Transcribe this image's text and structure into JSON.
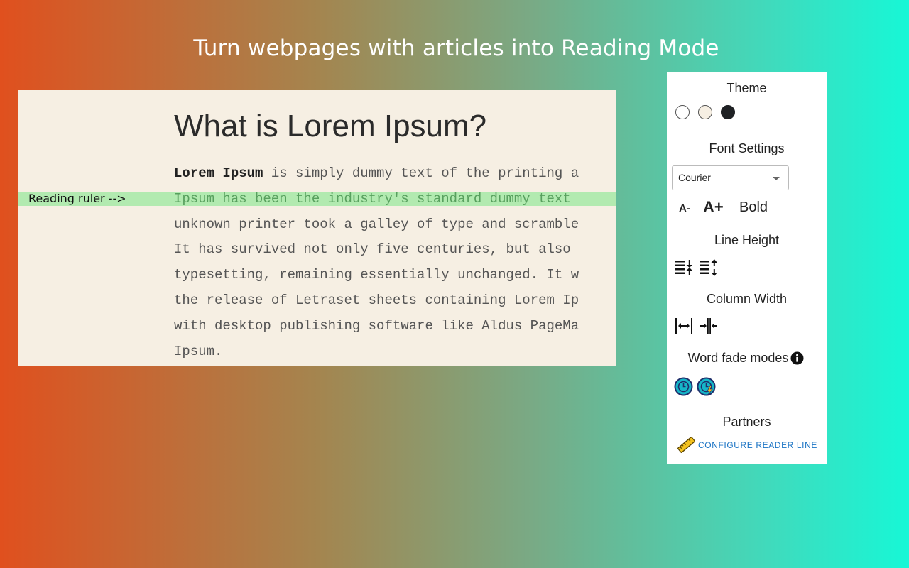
{
  "headline": "Turn webpages with articles into Reading Mode",
  "article": {
    "title": "What is Lorem Ipsum?",
    "line1_bold": "Lorem Ipsum",
    "line1_rest": " is simply dummy text of the printing a",
    "lines": [
      "Ipsum has been the industry's standard dummy text",
      "unknown printer took a galley of type and scramble",
      "It has survived not only five centuries, but also",
      "typesetting, remaining essentially unchanged. It w",
      "the release of Letraset sheets containing Lorem Ip",
      "with desktop publishing software like Aldus PageMa",
      "Ipsum."
    ],
    "ruler_label": "Reading ruler -->",
    "ruler_color": "#b2eab0"
  },
  "panel": {
    "theme_title": "Theme",
    "themes": [
      "#ffffff",
      "#f6efe3",
      "#1f2124"
    ],
    "font_title": "Font Settings",
    "font_value": "Courier",
    "font_decrease": "A-",
    "font_increase": "A+",
    "bold": "Bold",
    "line_height_title": "Line Height",
    "column_width_title": "Column Width",
    "word_fade_title": "Word fade modes",
    "partners_title": "Partners",
    "partner_link": "CONFIGURE READER LINE",
    "accent": "#1a73c4"
  }
}
